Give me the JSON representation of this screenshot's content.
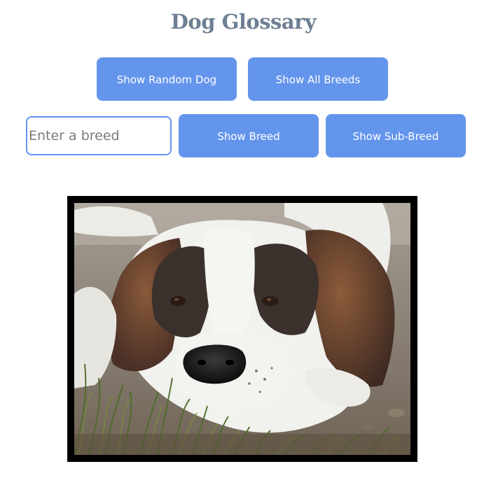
{
  "page": {
    "title": "Dog Glossary"
  },
  "buttons": {
    "random": "Show Random Dog",
    "all_breeds": "Show All Breeds",
    "breed": "Show Breed",
    "sub_breed": "Show Sub-Breed"
  },
  "breed_input": {
    "value": "",
    "placeholder": "Enter a breed"
  },
  "colors": {
    "title": "#6e7f92",
    "button_bg": "#6495ed",
    "button_text": "#ffffff",
    "input_border": "#6495ed",
    "frame": "#000000"
  },
  "image": {
    "subject": "dog-photo"
  }
}
